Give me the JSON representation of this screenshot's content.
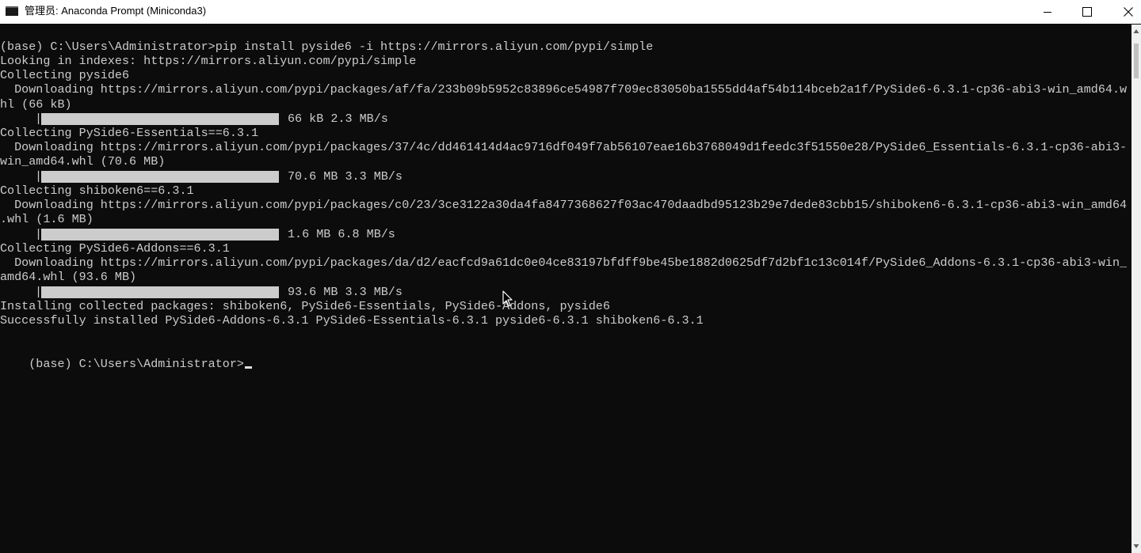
{
  "window": {
    "title": "管理员: Anaconda Prompt (Miniconda3)",
    "controls": [
      "minimize",
      "maximize",
      "close"
    ]
  },
  "console": {
    "lines": [
      "(base) C:\\Users\\Administrator>pip install pyside6 -i https://mirrors.aliyun.com/pypi/simple",
      "Looking in indexes: https://mirrors.aliyun.com/pypi/simple",
      "Collecting pyside6",
      "  Downloading https://mirrors.aliyun.com/pypi/packages/af/fa/233b09b5952c83896ce54987f709ec83050ba1555dd4af54b114bceb2a1f/PySide6-6.3.1-cp36-abi3-win_amd64.w",
      "hl (66 kB)",
      "Collecting PySide6-Essentials==6.3.1",
      "  Downloading https://mirrors.aliyun.com/pypi/packages/37/4c/dd461414d4ac9716df049f7ab56107eae16b3768049d1feedc3f51550e28/PySide6_Essentials-6.3.1-cp36-abi3-",
      "win_amd64.whl (70.6 MB)",
      "Collecting shiboken6==6.3.1",
      "  Downloading https://mirrors.aliyun.com/pypi/packages/c0/23/3ce3122a30da4fa8477368627f03ac470daadbd95123b29e7dede83cbb15/shiboken6-6.3.1-cp36-abi3-win_amd64",
      ".whl (1.6 MB)",
      "Collecting PySide6-Addons==6.3.1",
      "  Downloading https://mirrors.aliyun.com/pypi/packages/da/d2/eacfcd9a61dc0e04ce83197bfdff9be45be1882d0625df7d2bf1c13c014f/PySide6_Addons-6.3.1-cp36-abi3-win_",
      "amd64.whl (93.6 MB)",
      "Installing collected packages: shiboken6, PySide6-Essentials, PySide6-Addons, pyside6",
      "Successfully installed PySide6-Addons-6.3.1 PySide6-Essentials-6.3.1 pyside6-6.3.1 shiboken6-6.3.1",
      "(base) C:\\Users\\Administrator>"
    ],
    "progress_bars": [
      {
        "pipe": "|",
        "text": "66 kB 2.3 MB/s",
        "progress": 1.0
      },
      {
        "pipe": "|",
        "text": "70.6 MB 3.3 MB/s",
        "progress": 1.0
      },
      {
        "pipe": "|",
        "text": "1.6 MB 6.8 MB/s",
        "progress": 1.0
      },
      {
        "pipe": "|",
        "text": "93.6 MB 3.3 MB/s",
        "progress": 1.0
      }
    ],
    "colors": {
      "background": "#0c0c0c",
      "text": "#cccccc"
    }
  }
}
